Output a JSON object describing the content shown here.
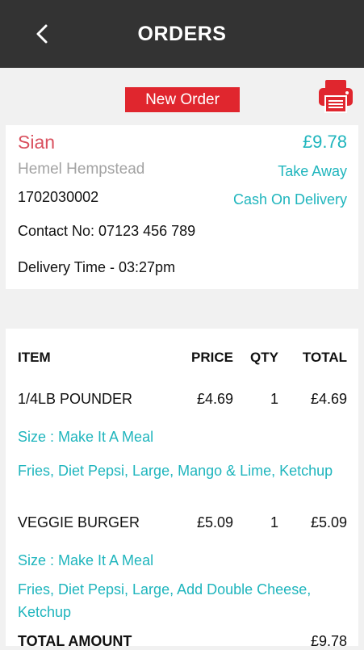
{
  "header": {
    "title": "ORDERS"
  },
  "status_button": "New Order",
  "order": {
    "customer_name": "Sian",
    "amount": "£9.78",
    "location": "Hemel Hempstead",
    "order_type": "Take Away",
    "order_number": "1702030002",
    "payment_method": "Cash On Delivery",
    "contact": "Contact No: 07123 456 789",
    "delivery_time": "Delivery Time - 03:27pm"
  },
  "items_table": {
    "headers": {
      "item": "ITEM",
      "price": "PRICE",
      "qty": "QTY",
      "total": "TOTAL"
    },
    "rows": [
      {
        "name": "1/4LB POUNDER",
        "price": "£4.69",
        "qty": "1",
        "total": "£4.69",
        "size": "Size : Make It A Meal",
        "extras": "Fries, Diet Pepsi, Large, Mango & Lime, Ketchup"
      },
      {
        "name": "VEGGIE BURGER",
        "price": "£5.09",
        "qty": "1",
        "total": "£5.09",
        "size": "Size : Make It A Meal",
        "extras_line1": "Fries, Diet Pepsi, Large, Add Double Cheese,",
        "extras_line2": "Ketchup"
      }
    ],
    "total_label": "TOTAL AMOUNT",
    "total_value": "£9.78"
  },
  "colors": {
    "topbar": "#333333",
    "accent_red": "#e0262e",
    "teal": "#1fb5bd",
    "name_red": "#d9505e"
  },
  "icons": {
    "back": "chevron-left-icon",
    "print": "printer-icon"
  }
}
